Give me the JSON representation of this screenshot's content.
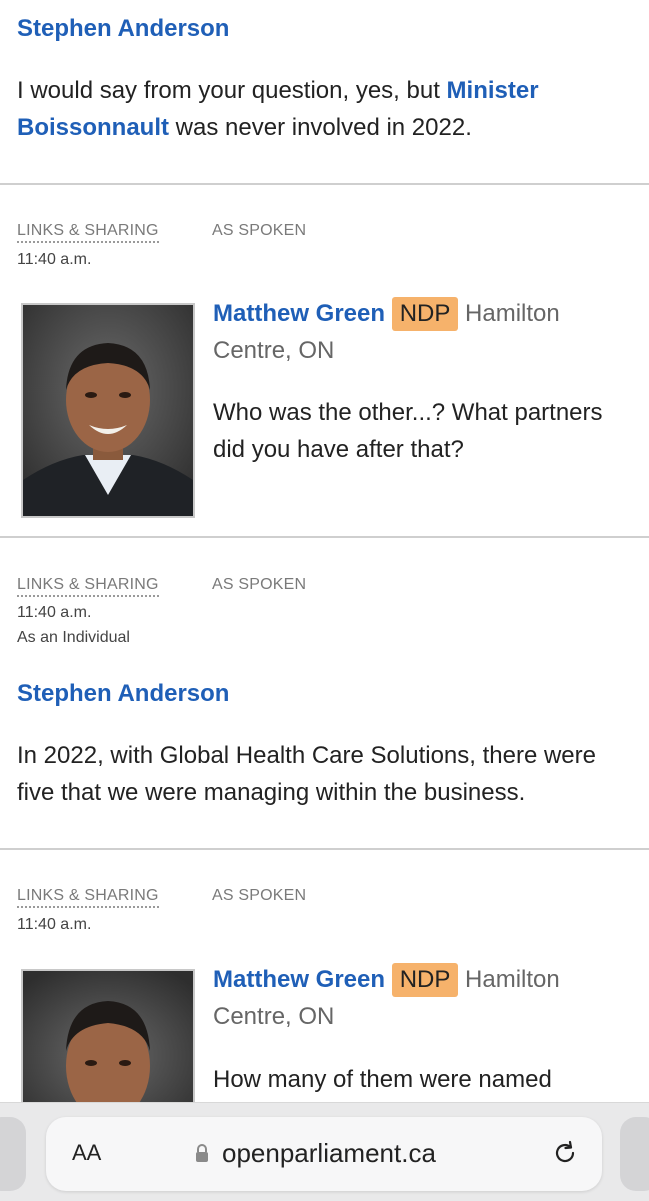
{
  "block1": {
    "speaker": "Stephen Anderson",
    "text_before": "I would say from your question, yes, but ",
    "link_text_1": "Minister",
    "link_text_2": "Boissonnault",
    "text_after": " was never involved in 2022."
  },
  "block2": {
    "links_sharing": "LINKS & SHARING",
    "as_spoken": "AS SPOKEN",
    "time": "11:40 a.m.",
    "mp_name": "Matthew Green",
    "party": "NDP",
    "riding_1": "Hamilton",
    "riding_2": "Centre, ON",
    "text_line_1": "Who was the other...? What partners",
    "text_line_2": "did you have after that?"
  },
  "block3": {
    "links_sharing": "LINKS & SHARING",
    "as_spoken": "AS SPOKEN",
    "time": "11:40 a.m.",
    "role": "As an Individual",
    "speaker": "Stephen Anderson",
    "text_line_1": "In 2022, with Global Health Care Solutions, there were",
    "text_line_2": "five that we were managing within the business."
  },
  "block4": {
    "links_sharing": "LINKS & SHARING",
    "as_spoken": "AS SPOKEN",
    "time": "11:40 a.m.",
    "mp_name": "Matthew Green",
    "party": "NDP",
    "riding_1": "Hamilton",
    "riding_2": "Centre, ON",
    "text_line_1": "How many of them were named"
  },
  "browser": {
    "text_size_label": "AA",
    "url": "openparliament.ca",
    "lock_icon": "lock-icon",
    "reload_icon": "reload-icon"
  },
  "colors": {
    "link_blue": "#1f5fb7",
    "party_ndp": "#f6b26b"
  }
}
